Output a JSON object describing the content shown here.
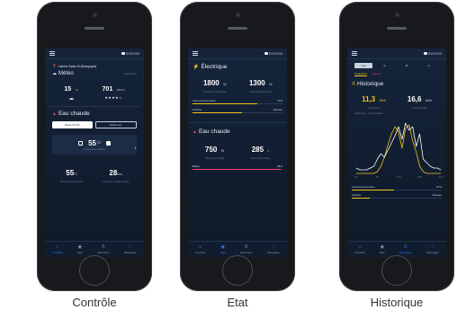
{
  "captions": {
    "p1": "Contrôle",
    "p2": "Etat",
    "p3": "Historique"
  },
  "brand": "SYSTOVI",
  "p1": {
    "location": "Lamine Systo 44 (Bourgogne)",
    "meteo_title": "Météo",
    "meteo_right": "Aujourd'hui",
    "temp_value": "15",
    "temp_unit": "°C",
    "irr_value": "701",
    "irr_unit": "Wh/m²",
    "stars": "★★★★☆",
    "eau_title": "Eau chaude",
    "mode_a": "Mode AUTO",
    "mode_b": "Mode éco",
    "setpoint": "55",
    "setpoint_unit": "°C",
    "setpoint_sub": "Température désirée",
    "stat_a_value": "55",
    "stat_a_unit": "°C",
    "stat_a_label": "Température du ballon",
    "stat_b_value": "28",
    "stat_b_unit": "min",
    "stat_b_label": "Temps de chauffe restant"
  },
  "p2": {
    "elec_title": "Électrique",
    "elec_a_value": "1800",
    "elec_a_unit": "W",
    "elec_a_label": "Production instantanée",
    "elec_b_value": "1300",
    "elec_b_unit": "W",
    "elec_b_label": "Consommation totale",
    "elec_bar_label": "Autoconsommation",
    "elec_bar_value": "72%",
    "elec_row_left": "Surplus",
    "elec_row_right": "Réseau",
    "eau_title": "Eau chaude",
    "eau_a_value": "750",
    "eau_a_unit": "W",
    "eau_a_label": "Puissance chauffe",
    "eau_b_value": "285",
    "eau_b_unit": "L",
    "eau_b_label": "Eau chaude dispo",
    "eau_bar_label": "Ballon",
    "eau_bar_value": "98%"
  },
  "p3": {
    "seg": [
      "Jour",
      "S",
      "M",
      "A"
    ],
    "tag_left": "Production",
    "tag_right": "Conso",
    "hist_title": "Historique",
    "h_a_value": "11,3",
    "h_a_unit": "kWh",
    "h_a_label": "Production",
    "h_b_value": "16,6",
    "h_b_unit": "kWh",
    "h_b_label": "Consommation",
    "chart_legend": "Production · Consommation",
    "x_ticks": [
      "0h",
      "6h",
      "12h",
      "18h",
      "24h"
    ],
    "footer_bar_label": "Autoconsommation",
    "footer_bar_value": "47%",
    "footer_left": "Surplus",
    "footer_right": "Réseau"
  },
  "tabs": [
    {
      "label": "Contrôle",
      "icon": "home-icon"
    },
    {
      "label": "Etat",
      "icon": "eye-icon"
    },
    {
      "label": "Historique",
      "icon": "chart-icon"
    },
    {
      "label": "Messages",
      "icon": "chat-icon"
    }
  ],
  "colors": {
    "production": "#f5c21b",
    "conso": "#ffffff",
    "accent": "#3b7cff",
    "hot": "#ff3a6e"
  },
  "chart_data": {
    "type": "line",
    "x": [
      0,
      1,
      2,
      3,
      4,
      5,
      6,
      7,
      8,
      9,
      10,
      11,
      12,
      13,
      14,
      15,
      16,
      17,
      18,
      19,
      20,
      21,
      22,
      23,
      24
    ],
    "series": [
      {
        "name": "Production",
        "values": [
          0,
          0,
          0,
          0,
          0,
          0,
          0.1,
          0.4,
          0.9,
          1.6,
          2.2,
          2.6,
          2.3,
          1.4,
          2.5,
          2.7,
          1.8,
          1.2,
          0.4,
          0.1,
          0,
          0,
          0,
          0,
          0
        ]
      },
      {
        "name": "Consommation",
        "values": [
          0.3,
          0.2,
          0.2,
          0.2,
          0.3,
          0.4,
          0.8,
          1.1,
          0.9,
          1.3,
          1.7,
          2.1,
          2.6,
          1.9,
          2.8,
          2.4,
          2.6,
          1.5,
          2.2,
          0.8,
          0.6,
          0.4,
          0.3,
          0.3,
          0.2
        ]
      }
    ],
    "ylim": [
      0,
      3
    ]
  }
}
